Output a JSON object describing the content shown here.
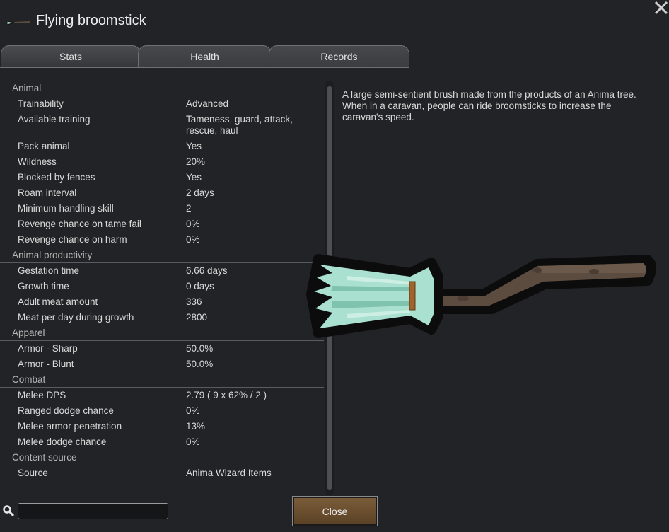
{
  "window": {
    "title": "Flying broomstick"
  },
  "tabs": [
    {
      "label": "Stats"
    },
    {
      "label": "Health"
    },
    {
      "label": "Records"
    }
  ],
  "stats": {
    "animal": {
      "title": "Animal",
      "rows": [
        {
          "label": "Trainability",
          "value": "Advanced"
        },
        {
          "label": "Available training",
          "value": "Tameness, guard, attack, rescue, haul"
        },
        {
          "label": "Pack animal",
          "value": "Yes"
        },
        {
          "label": "Wildness",
          "value": "20%"
        },
        {
          "label": "Blocked by fences",
          "value": "Yes"
        },
        {
          "label": "Roam interval",
          "value": "2 days"
        },
        {
          "label": "Minimum handling skill",
          "value": "2"
        },
        {
          "label": "Revenge chance on tame fail",
          "value": "0%"
        },
        {
          "label": "Revenge chance on harm",
          "value": "0%"
        }
      ]
    },
    "productivity": {
      "title": "Animal productivity",
      "rows": [
        {
          "label": "Gestation time",
          "value": "6.66 days"
        },
        {
          "label": "Growth time",
          "value": "0 days"
        },
        {
          "label": "Adult meat amount",
          "value": "336"
        },
        {
          "label": "Meat per day during growth",
          "value": "2800"
        }
      ]
    },
    "apparel": {
      "title": "Apparel",
      "rows": [
        {
          "label": "Armor - Sharp",
          "value": "50.0%"
        },
        {
          "label": "Armor - Blunt",
          "value": "50.0%"
        }
      ]
    },
    "combat": {
      "title": "Combat",
      "rows": [
        {
          "label": "Melee DPS",
          "value": "2.79 ( 9 x 62% / 2 )"
        },
        {
          "label": "Ranged dodge chance",
          "value": "0%"
        },
        {
          "label": "Melee armor penetration",
          "value": "13%"
        },
        {
          "label": "Melee dodge chance",
          "value": "0%"
        }
      ]
    },
    "content": {
      "title": "Content source",
      "rows": [
        {
          "label": "Source",
          "value": "Anima Wizard Items"
        }
      ]
    }
  },
  "description": "A large semi-sentient brush made from the products of an Anima tree.\nWhen in a caravan, people can ride broomsticks to increase the caravan's speed.",
  "search": {
    "value": "",
    "placeholder": ""
  },
  "footer": {
    "close_label": "Close"
  },
  "icons": {
    "title": "broomstick-icon",
    "close": "close-icon",
    "search": "search-icon"
  },
  "colors": {
    "background": "#222326",
    "close_button": "#6b4e2f",
    "bristles": "#a9e0cf",
    "handle": "#5c4c3f",
    "binding": "#a0642a"
  }
}
